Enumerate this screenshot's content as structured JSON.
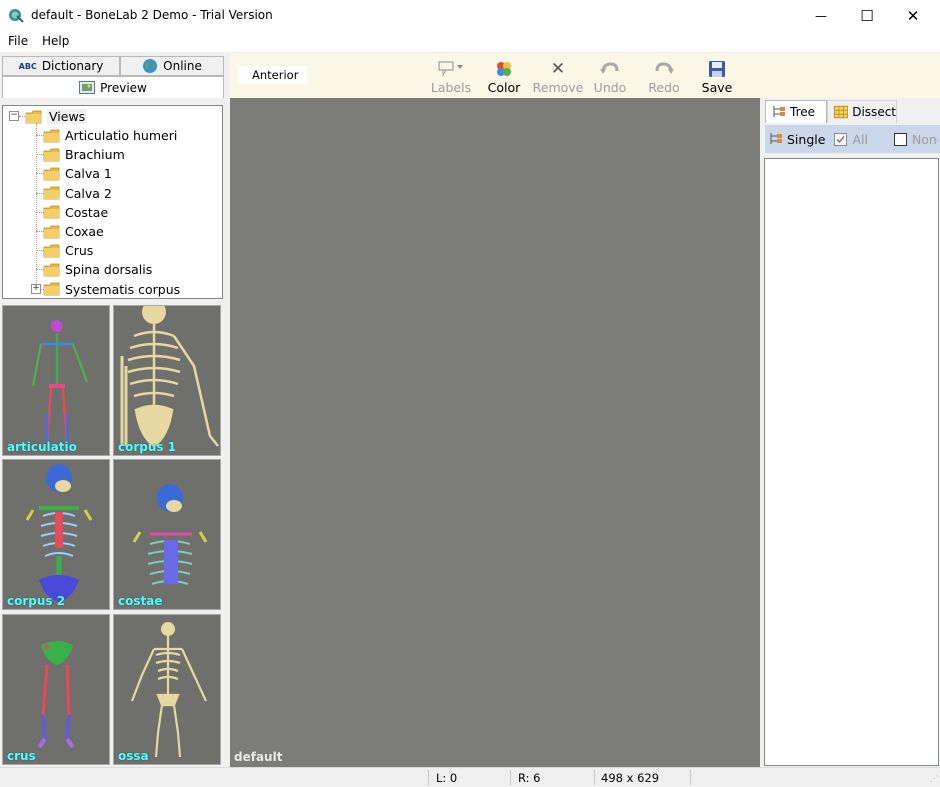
{
  "window": {
    "title": "default - BoneLab 2 Demo - Trial Version",
    "minimize_glyph": "—",
    "maximize_glyph": "☐",
    "close_glyph": "✕"
  },
  "menu": {
    "file": "File",
    "help": "Help"
  },
  "left_tabs": {
    "dictionary": "Dictionary",
    "dictionary_icon_text": "ABC",
    "online": "Online",
    "preview": "Preview"
  },
  "tree": {
    "root": "Views",
    "root_expander": "−",
    "items": [
      "Articulatio humeri",
      "Brachium",
      "Calva 1",
      "Calva 2",
      "Costae",
      "Coxae",
      "Crus",
      "Spina dorsalis",
      "Systematis corpus"
    ],
    "last_expander": "+"
  },
  "thumbnails": [
    "articulatio",
    "corpus 1",
    "corpus 2",
    "costae",
    "crus",
    "ossa"
  ],
  "toolbar": {
    "view": "Anterior",
    "labels": "Labels",
    "color": "Color",
    "remove": "Remove",
    "undo": "Undo",
    "redo": "Redo",
    "save": "Save"
  },
  "viewport": {
    "label": "default"
  },
  "right_panel": {
    "tab_tree": "Tree",
    "tab_dissect": "Dissect",
    "single": "Single",
    "all": "All",
    "none": "None"
  },
  "status": {
    "l": "L: 0",
    "r": "R: 6",
    "size": "498 x 629"
  },
  "colors": {
    "viewport_bg": "#7c7c78",
    "toolbar_bg": "#fbf7e6",
    "thumb_label": "#55ffff",
    "filterbar_bg": "#cad7eb",
    "bone": "#e6d8a0"
  },
  "icons": {
    "app": "bonelab-app-icon",
    "folder": "folder-icon",
    "globe": "globe-icon",
    "preview": "preview-icon",
    "labels": "labels-icon",
    "color": "color-palette-icon",
    "remove": "x-icon",
    "undo": "undo-icon",
    "redo": "redo-icon",
    "save": "floppy-disk-icon",
    "tree": "tree-icon",
    "dissect": "grid-icon"
  }
}
